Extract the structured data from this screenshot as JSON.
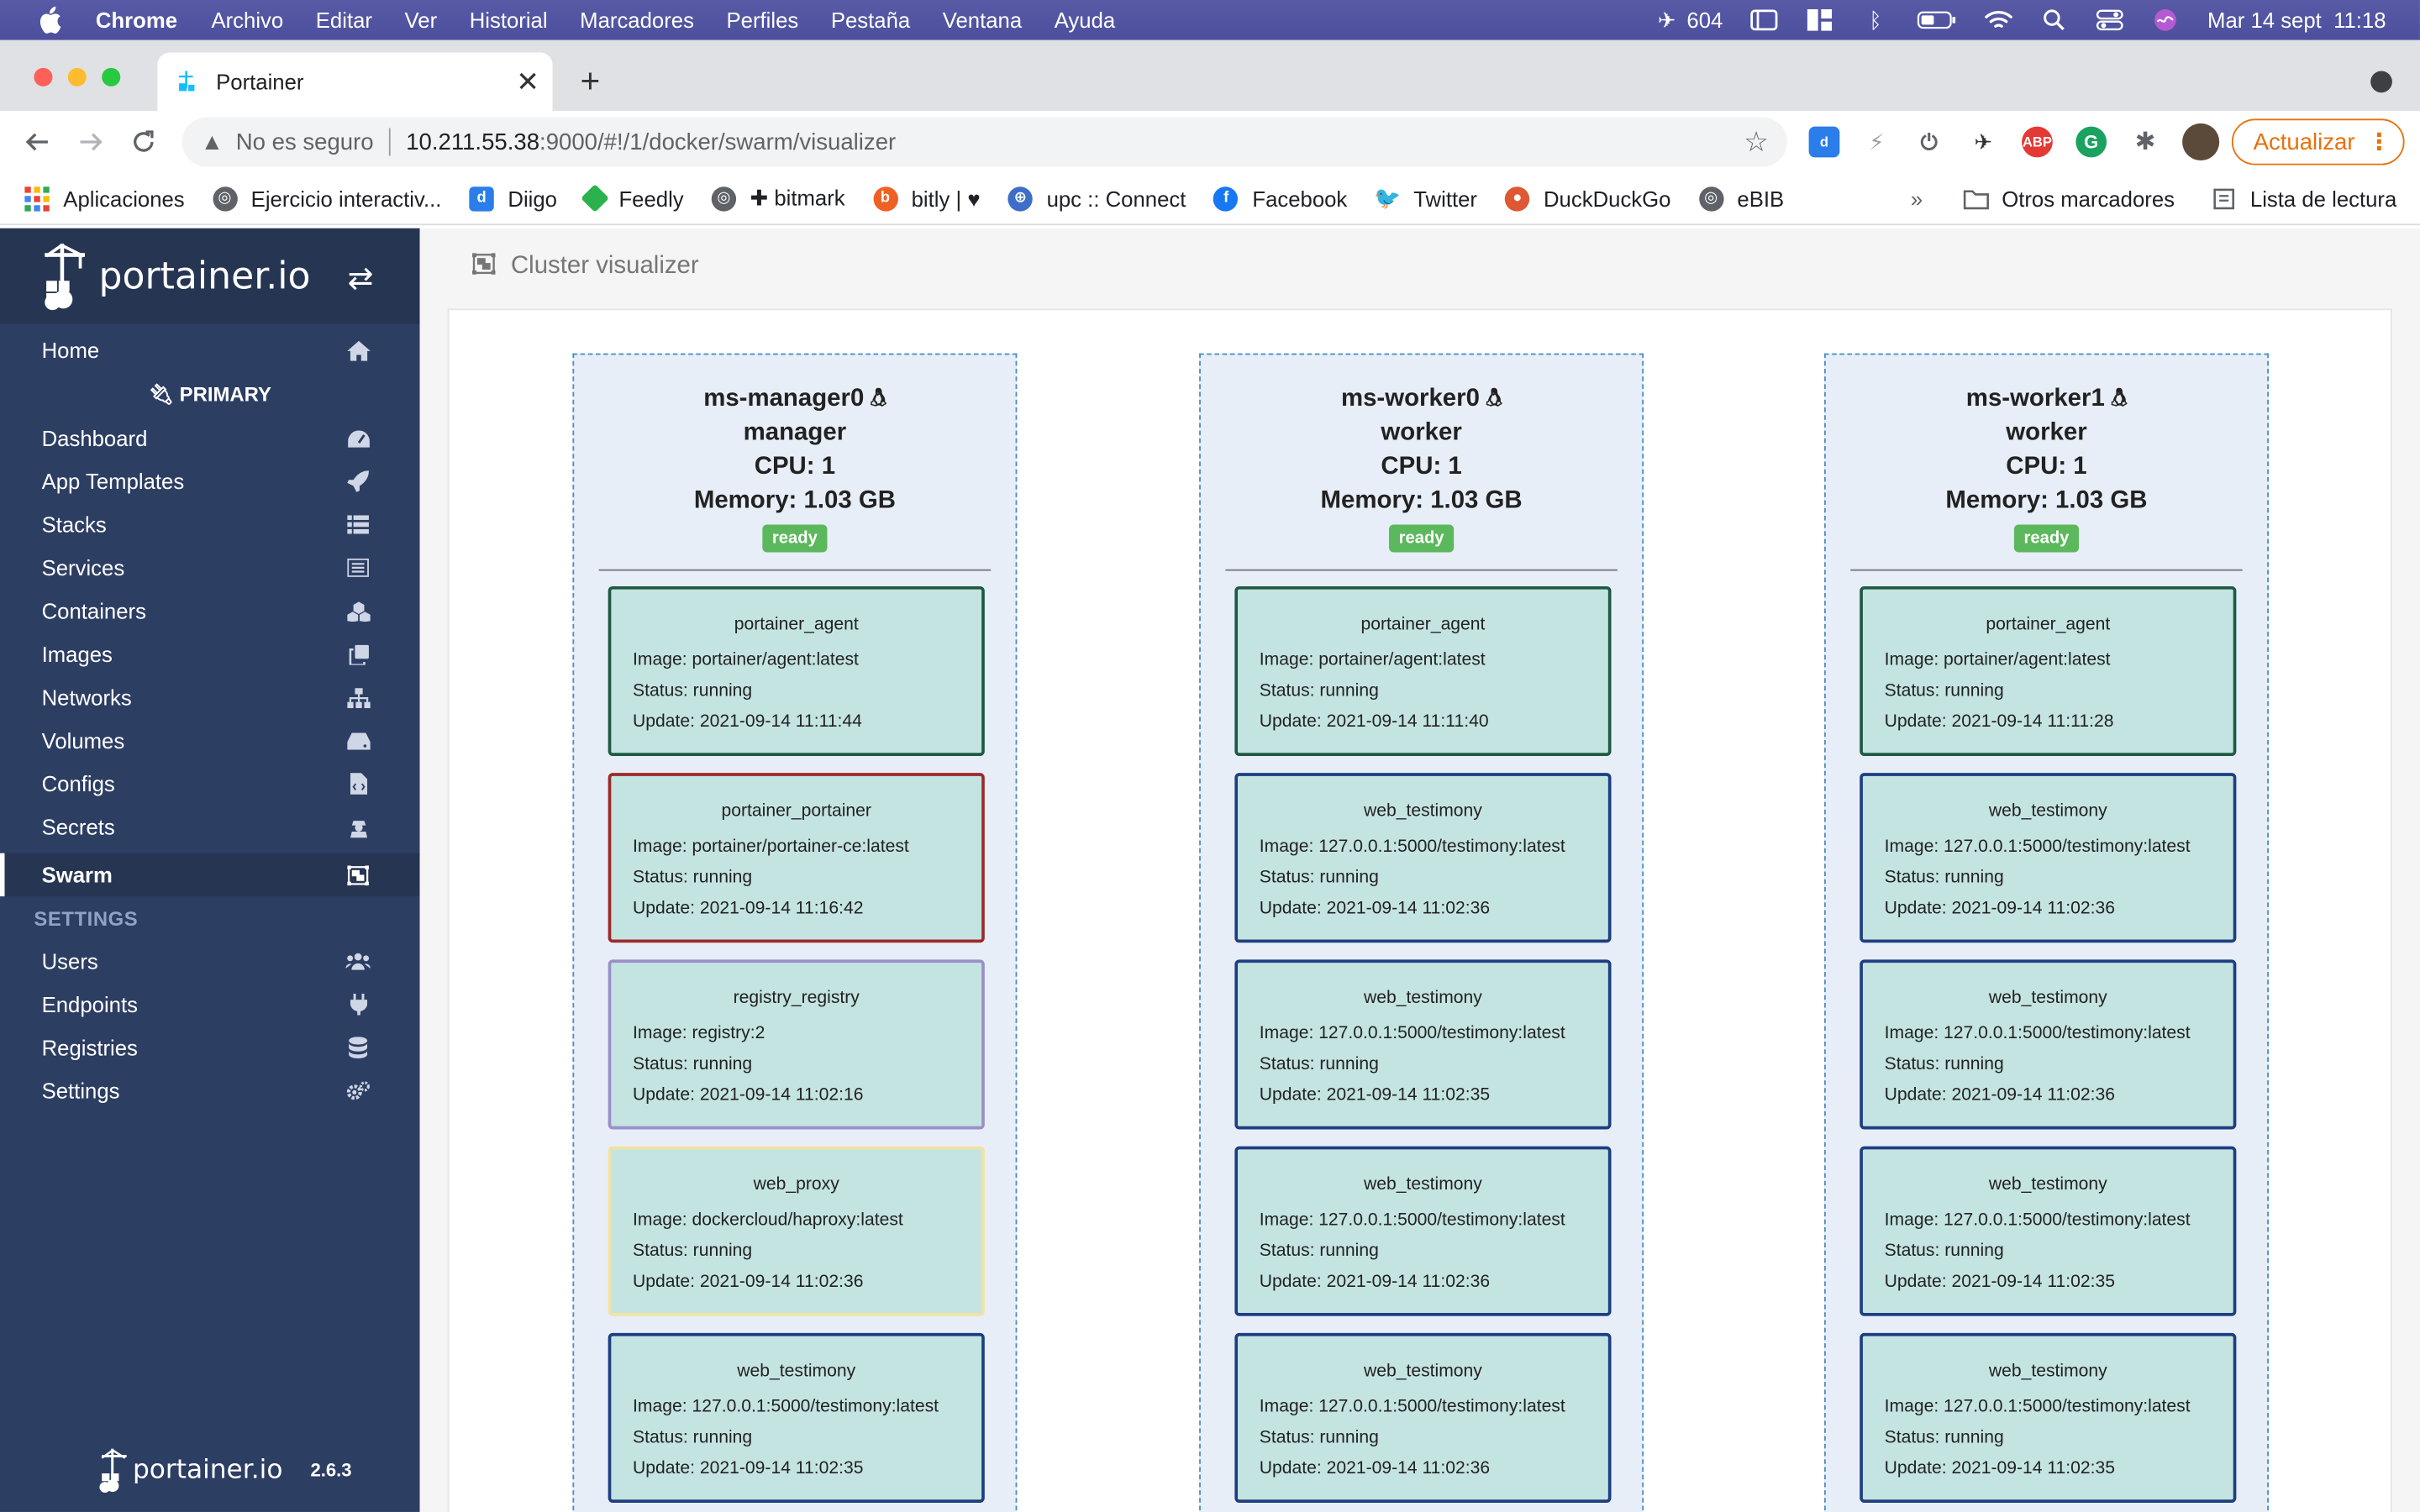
{
  "menubar": {
    "items": [
      "Chrome",
      "Archivo",
      "Editar",
      "Ver",
      "Historial",
      "Marcadores",
      "Perfiles",
      "Pestaña",
      "Ventana",
      "Ayuda"
    ],
    "flight_count": "604",
    "datetime": "Mar 14 sept  11:18"
  },
  "browser": {
    "tab_title": "Portainer",
    "security_label": "No es seguro",
    "url_host": "10.211.55.38",
    "url_path": ":9000/#!/1/docker/swarm/visualizer",
    "update_label": "Actualizar",
    "bookmarks": [
      {
        "label": "Aplicaciones",
        "color": "#e94235"
      },
      {
        "label": "Ejercicio interactiv...",
        "color": "#5f6368"
      },
      {
        "label": "Diigo",
        "color": "#2b7de9"
      },
      {
        "label": "Feedly",
        "color": "#2bb24c"
      },
      {
        "label": "✚ bitmark",
        "color": "#5f6368"
      },
      {
        "label": "bitly | ♥",
        "color": "#ee6123"
      },
      {
        "label": "upc :: Connect",
        "color": "#3d6ec9"
      },
      {
        "label": "Facebook",
        "color": "#1877f2"
      },
      {
        "label": "Twitter",
        "color": "#1da1f2"
      },
      {
        "label": "DuckDuckGo",
        "color": "#de5833"
      },
      {
        "label": "eBIB",
        "color": "#5f6368"
      }
    ],
    "more": "»",
    "other_bookmarks": "Otros marcadores",
    "reading_list": "Lista de lectura"
  },
  "sidebar": {
    "brand": "portainer.io",
    "endpoint": "PRIMARY",
    "items": [
      {
        "label": "Home",
        "icon": "home-icon"
      },
      {
        "label": "Dashboard",
        "icon": "dashboard-icon"
      },
      {
        "label": "App Templates",
        "icon": "rocket-icon"
      },
      {
        "label": "Stacks",
        "icon": "list-icon"
      },
      {
        "label": "Services",
        "icon": "services-icon"
      },
      {
        "label": "Containers",
        "icon": "cubes-icon"
      },
      {
        "label": "Images",
        "icon": "clone-icon"
      },
      {
        "label": "Networks",
        "icon": "sitemap-icon"
      },
      {
        "label": "Volumes",
        "icon": "hdd-icon"
      },
      {
        "label": "Configs",
        "icon": "file-code-icon"
      },
      {
        "label": "Secrets",
        "icon": "user-secret-icon"
      },
      {
        "label": "Swarm",
        "icon": "object-group-icon"
      }
    ],
    "settings_heading": "SETTINGS",
    "settings_items": [
      {
        "label": "Users",
        "icon": "users-icon"
      },
      {
        "label": "Endpoints",
        "icon": "plug-icon"
      },
      {
        "label": "Registries",
        "icon": "database-icon"
      },
      {
        "label": "Settings",
        "icon": "cogs-icon"
      }
    ],
    "footer_brand": "portainer.io",
    "version": "2.6.3"
  },
  "main": {
    "title": "Cluster visualizer",
    "nodes": [
      {
        "name": "ms-manager0",
        "role": "manager",
        "cpu": "CPU: 1",
        "memory": "Memory: 1.03 GB",
        "status": "ready",
        "tasks": [
          {
            "name": "portainer_agent",
            "image": "Image: portainer/agent:latest",
            "status": "Status: running",
            "update": "Update: 2021-09-14 11:11:44",
            "border": "#1e5a43"
          },
          {
            "name": "portainer_portainer",
            "image": "Image: portainer/portainer-ce:latest",
            "status": "Status: running",
            "update": "Update: 2021-09-14 11:16:42",
            "border": "#9c2a2a"
          },
          {
            "name": "registry_registry",
            "image": "Image: registry:2",
            "status": "Status: running",
            "update": "Update: 2021-09-14 11:02:16",
            "border": "#9a8fc9"
          },
          {
            "name": "web_proxy",
            "image": "Image: dockercloud/haproxy:latest",
            "status": "Status: running",
            "update": "Update: 2021-09-14 11:02:36",
            "border": "#f1e3a2"
          },
          {
            "name": "web_testimony",
            "image": "Image: 127.0.0.1:5000/testimony:latest",
            "status": "Status: running",
            "update": "Update: 2021-09-14 11:02:35",
            "border": "#1d3e82"
          }
        ]
      },
      {
        "name": "ms-worker0",
        "role": "worker",
        "cpu": "CPU: 1",
        "memory": "Memory: 1.03 GB",
        "status": "ready",
        "tasks": [
          {
            "name": "portainer_agent",
            "image": "Image: portainer/agent:latest",
            "status": "Status: running",
            "update": "Update: 2021-09-14 11:11:40",
            "border": "#1e5a43"
          },
          {
            "name": "web_testimony",
            "image": "Image: 127.0.0.1:5000/testimony:latest",
            "status": "Status: running",
            "update": "Update: 2021-09-14 11:02:36",
            "border": "#1d3e82"
          },
          {
            "name": "web_testimony",
            "image": "Image: 127.0.0.1:5000/testimony:latest",
            "status": "Status: running",
            "update": "Update: 2021-09-14 11:02:35",
            "border": "#1d3e82"
          },
          {
            "name": "web_testimony",
            "image": "Image: 127.0.0.1:5000/testimony:latest",
            "status": "Status: running",
            "update": "Update: 2021-09-14 11:02:36",
            "border": "#1d3e82"
          },
          {
            "name": "web_testimony",
            "image": "Image: 127.0.0.1:5000/testimony:latest",
            "status": "Status: running",
            "update": "Update: 2021-09-14 11:02:36",
            "border": "#1d3e82"
          }
        ]
      },
      {
        "name": "ms-worker1",
        "role": "worker",
        "cpu": "CPU: 1",
        "memory": "Memory: 1.03 GB",
        "status": "ready",
        "tasks": [
          {
            "name": "portainer_agent",
            "image": "Image: portainer/agent:latest",
            "status": "Status: running",
            "update": "Update: 2021-09-14 11:11:28",
            "border": "#1e5a43"
          },
          {
            "name": "web_testimony",
            "image": "Image: 127.0.0.1:5000/testimony:latest",
            "status": "Status: running",
            "update": "Update: 2021-09-14 11:02:36",
            "border": "#1d3e82"
          },
          {
            "name": "web_testimony",
            "image": "Image: 127.0.0.1:5000/testimony:latest",
            "status": "Status: running",
            "update": "Update: 2021-09-14 11:02:36",
            "border": "#1d3e82"
          },
          {
            "name": "web_testimony",
            "image": "Image: 127.0.0.1:5000/testimony:latest",
            "status": "Status: running",
            "update": "Update: 2021-09-14 11:02:35",
            "border": "#1d3e82"
          },
          {
            "name": "web_testimony",
            "image": "Image: 127.0.0.1:5000/testimony:latest",
            "status": "Status: running",
            "update": "Update: 2021-09-14 11:02:35",
            "border": "#1d3e82"
          }
        ]
      }
    ]
  }
}
